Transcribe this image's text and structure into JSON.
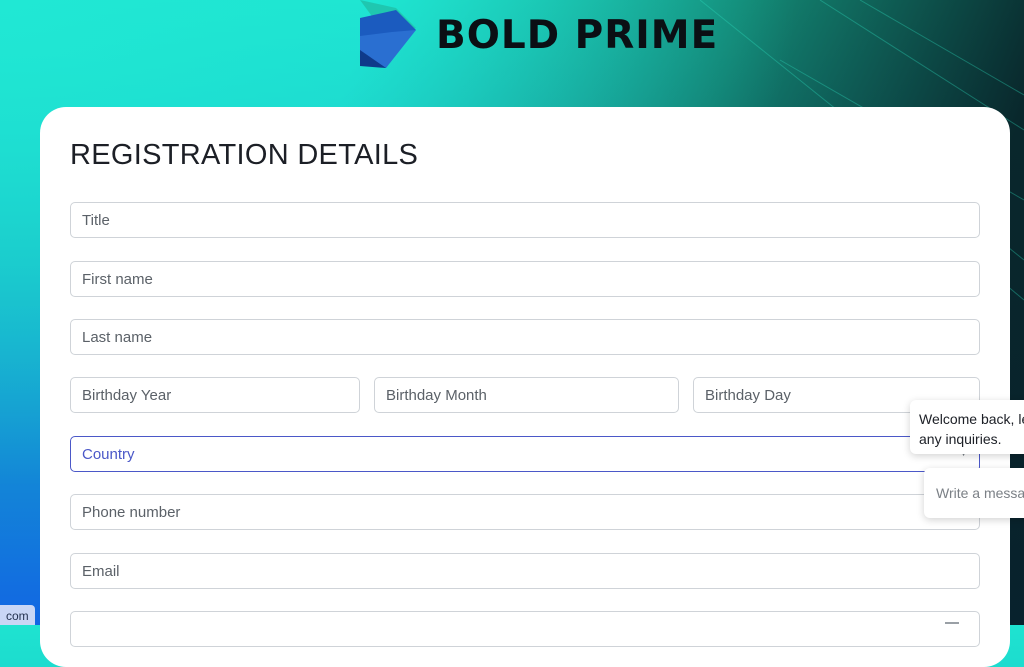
{
  "brand": {
    "name": "BOLD PRIME"
  },
  "form": {
    "title": "REGISTRATION DETAILS",
    "title_field": "Title",
    "first_name": "First name",
    "last_name": "Last name",
    "birthday_year": "Birthday Year",
    "birthday_month": "Birthday Month",
    "birthday_day": "Birthday Day",
    "country": "Country",
    "phone": "Phone number",
    "email": "Email"
  },
  "chat": {
    "greeting": "Welcome back, le any inquiries.",
    "input_placeholder": "Write a messa"
  },
  "status_bar": {
    "url_fragment": "com"
  },
  "colors": {
    "accent": "#4b58c8",
    "teal": "#1ee3d0",
    "blue": "#1266e3"
  }
}
